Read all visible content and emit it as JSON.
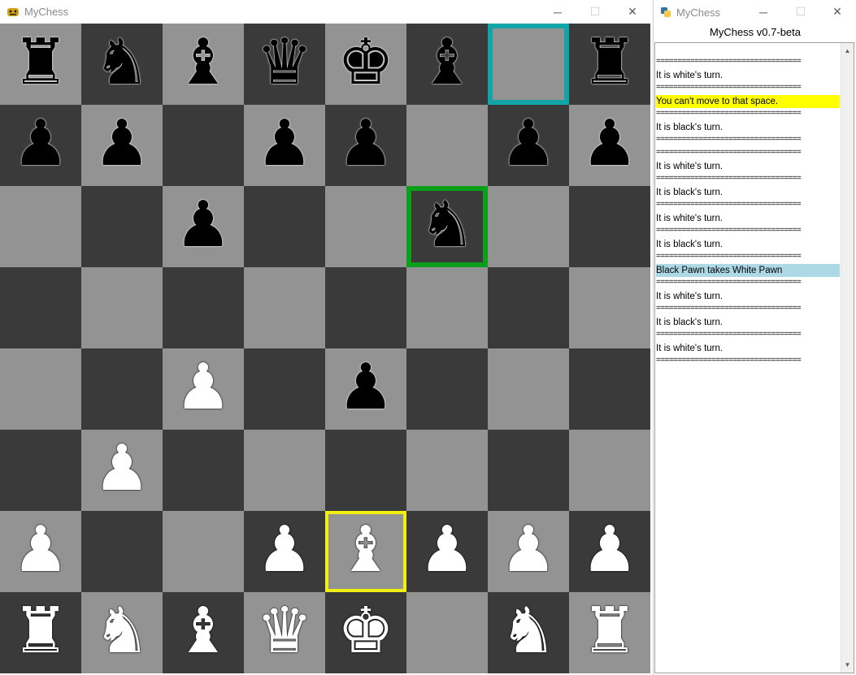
{
  "board_window": {
    "title": "MyChess",
    "controls": {
      "minimize": "─",
      "maximize": "☐",
      "close": "✕"
    }
  },
  "log_window": {
    "title": "MyChess",
    "header": "MyChess v0.7-beta",
    "controls": {
      "minimize": "─",
      "maximize": "☐",
      "close": "✕"
    }
  },
  "board": {
    "colors": {
      "light": "#939393",
      "dark": "#3a3a3a",
      "selected_teal": "#12a5a8",
      "selected_green": "#0b9e1a",
      "selected_yellow": "#f1ef12"
    },
    "squares": [
      [
        {
          "piece": "rook",
          "color": "black"
        },
        {
          "piece": "knight",
          "color": "black"
        },
        {
          "piece": "bishop",
          "color": "black"
        },
        {
          "piece": "queen",
          "color": "black"
        },
        {
          "piece": "king",
          "color": "black"
        },
        {
          "piece": "bishop",
          "color": "black"
        },
        {
          "piece": null,
          "highlight": "teal"
        },
        {
          "piece": "rook",
          "color": "black"
        }
      ],
      [
        {
          "piece": "pawn",
          "color": "black"
        },
        {
          "piece": "pawn",
          "color": "black"
        },
        {
          "piece": null
        },
        {
          "piece": "pawn",
          "color": "black"
        },
        {
          "piece": "pawn",
          "color": "black"
        },
        {
          "piece": null
        },
        {
          "piece": "pawn",
          "color": "black"
        },
        {
          "piece": "pawn",
          "color": "black"
        }
      ],
      [
        {
          "piece": null
        },
        {
          "piece": null
        },
        {
          "piece": "pawn",
          "color": "black"
        },
        {
          "piece": null
        },
        {
          "piece": null
        },
        {
          "piece": "knight",
          "color": "black",
          "highlight": "green"
        },
        {
          "piece": null
        },
        {
          "piece": null
        }
      ],
      [
        {
          "piece": null
        },
        {
          "piece": null
        },
        {
          "piece": null
        },
        {
          "piece": null
        },
        {
          "piece": null
        },
        {
          "piece": null
        },
        {
          "piece": null
        },
        {
          "piece": null
        }
      ],
      [
        {
          "piece": null
        },
        {
          "piece": null
        },
        {
          "piece": "pawn",
          "color": "white"
        },
        {
          "piece": null
        },
        {
          "piece": "pawn",
          "color": "black"
        },
        {
          "piece": null
        },
        {
          "piece": null
        },
        {
          "piece": null
        }
      ],
      [
        {
          "piece": null
        },
        {
          "piece": "pawn",
          "color": "white"
        },
        {
          "piece": null
        },
        {
          "piece": null
        },
        {
          "piece": null
        },
        {
          "piece": null
        },
        {
          "piece": null
        },
        {
          "piece": null
        }
      ],
      [
        {
          "piece": "pawn",
          "color": "white"
        },
        {
          "piece": null
        },
        {
          "piece": null
        },
        {
          "piece": "pawn",
          "color": "white"
        },
        {
          "piece": "bishop",
          "color": "white",
          "highlight": "yellow"
        },
        {
          "piece": "pawn",
          "color": "white"
        },
        {
          "piece": "pawn",
          "color": "white"
        },
        {
          "piece": "pawn",
          "color": "white"
        }
      ],
      [
        {
          "piece": "rook",
          "color": "white"
        },
        {
          "piece": "knight",
          "color": "white"
        },
        {
          "piece": "bishop",
          "color": "white"
        },
        {
          "piece": "queen",
          "color": "white"
        },
        {
          "piece": "king",
          "color": "white"
        },
        {
          "piece": null
        },
        {
          "piece": "knight",
          "color": "white"
        },
        {
          "piece": "rook",
          "color": "white"
        }
      ]
    ]
  },
  "log": {
    "highlight_colors": {
      "warn": "#ffff00",
      "info": "#add8e6"
    },
    "lines": [
      {
        "text": "==================================",
        "kind": "sep"
      },
      {
        "text": "It is white's turn.",
        "kind": "normal"
      },
      {
        "text": "==================================",
        "kind": "sep"
      },
      {
        "text": "You can't move to that space.",
        "kind": "warn"
      },
      {
        "text": "==================================",
        "kind": "sep"
      },
      {
        "text": "It is black's turn.",
        "kind": "normal"
      },
      {
        "text": "==================================",
        "kind": "sep"
      },
      {
        "text": "==================================",
        "kind": "sep"
      },
      {
        "text": "It is white's turn.",
        "kind": "normal"
      },
      {
        "text": "==================================",
        "kind": "sep"
      },
      {
        "text": "It is black's turn.",
        "kind": "normal"
      },
      {
        "text": "==================================",
        "kind": "sep"
      },
      {
        "text": "It is white's turn.",
        "kind": "normal"
      },
      {
        "text": "==================================",
        "kind": "sep"
      },
      {
        "text": "It is black's turn.",
        "kind": "normal"
      },
      {
        "text": "==================================",
        "kind": "sep"
      },
      {
        "text": "Black Pawn takes White Pawn",
        "kind": "info"
      },
      {
        "text": "==================================",
        "kind": "sep"
      },
      {
        "text": "It is white's turn.",
        "kind": "normal"
      },
      {
        "text": "==================================",
        "kind": "sep"
      },
      {
        "text": "It is black's turn.",
        "kind": "normal"
      },
      {
        "text": "==================================",
        "kind": "sep"
      },
      {
        "text": "It is white's turn.",
        "kind": "normal"
      },
      {
        "text": "==================================",
        "kind": "sep"
      }
    ]
  }
}
